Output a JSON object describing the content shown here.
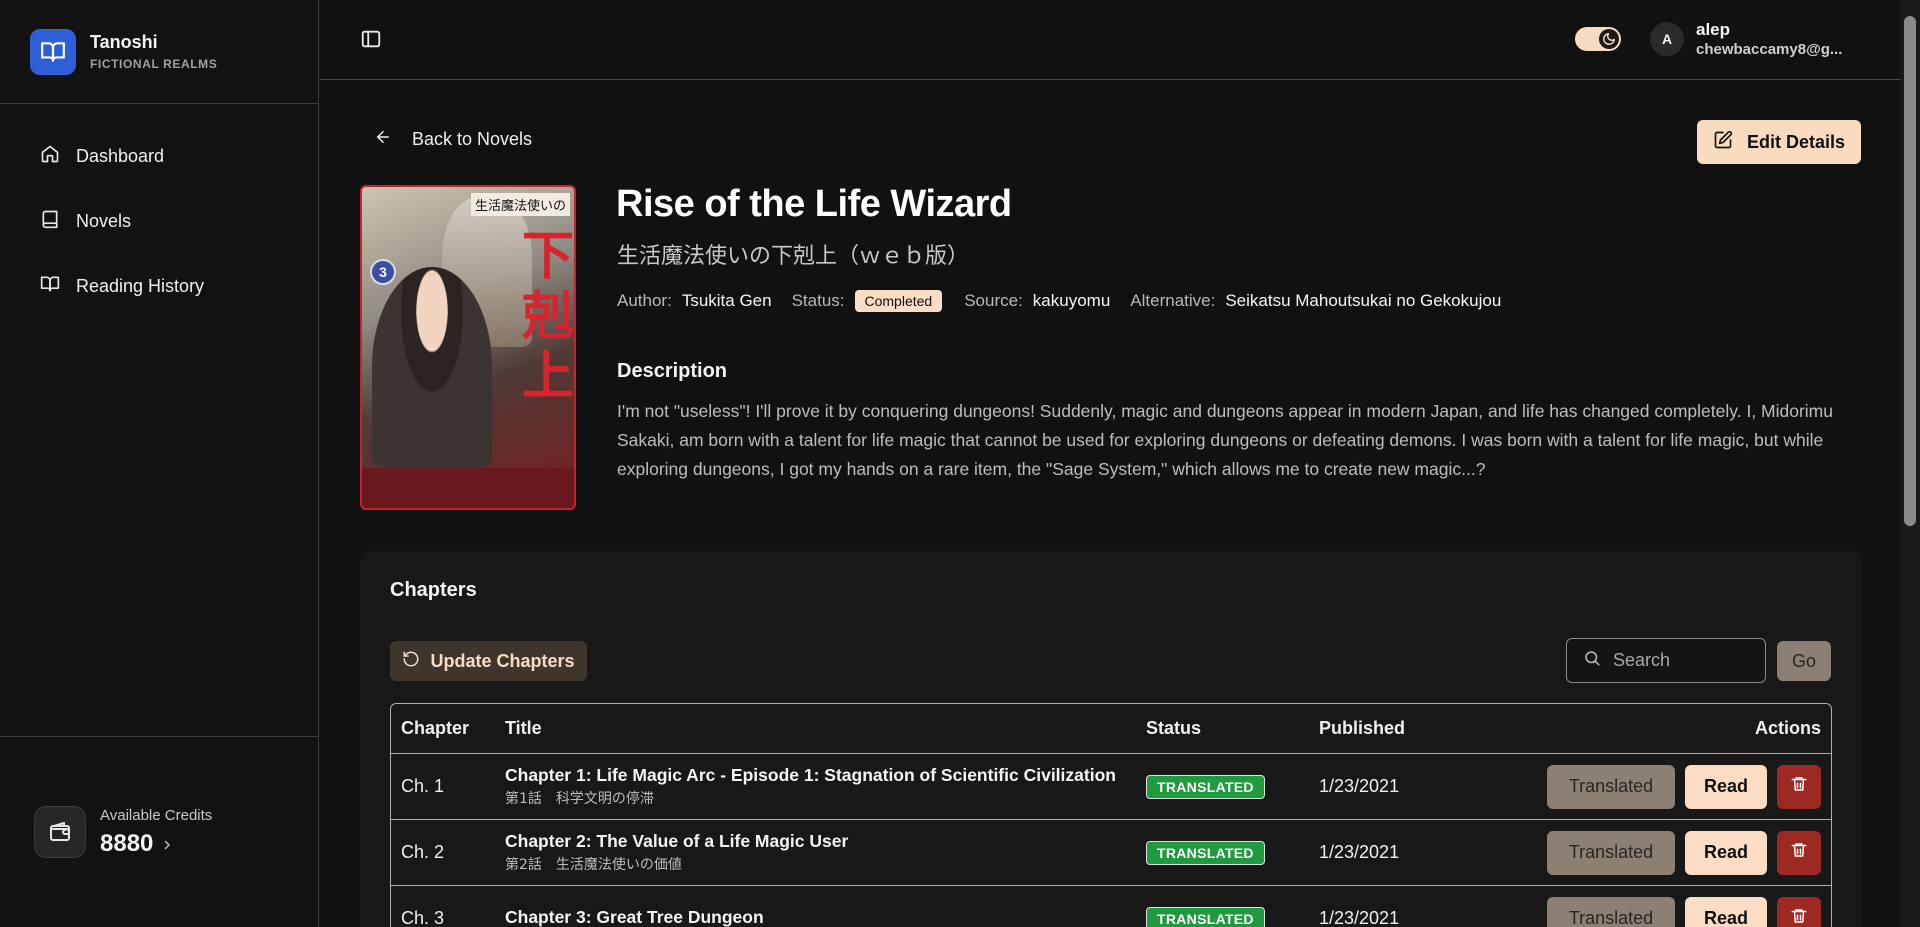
{
  "brand": {
    "name": "Tanoshi",
    "tagline": "FICTIONAL REALMS",
    "logo_icon": "book-open-icon",
    "logo_color": "#2f5fd6"
  },
  "nav": [
    {
      "label": "Dashboard",
      "icon": "home-icon"
    },
    {
      "label": "Novels",
      "icon": "book-icon"
    },
    {
      "label": "Reading History",
      "icon": "book-open-icon"
    }
  ],
  "credits": {
    "label": "Available Credits",
    "amount": "8880",
    "icon": "wallet-icon"
  },
  "topbar": {
    "theme_toggle": {
      "icon": "moon-icon",
      "state": "dark"
    },
    "user": {
      "initial": "A",
      "name": "alep",
      "email": "chewbaccamy8@g..."
    }
  },
  "page": {
    "back_label": "Back to Novels",
    "edit_label": "Edit Details",
    "cover": {
      "title_strip": "生活魔法使いの",
      "big_text": "下剋上",
      "volume": "3"
    },
    "title": "Rise of the Life Wizard",
    "original_title": "生活魔法使いの下剋上（ｗｅｂ版）",
    "meta": {
      "author_key": "Author:",
      "author": "Tsukita Gen",
      "status_key": "Status:",
      "status": "Completed",
      "source_key": "Source:",
      "source": "kakuyomu",
      "alt_key": "Alternative:",
      "alternative": "Seikatsu Mahoutsukai no Gekokujou"
    },
    "description_heading": "Description",
    "description": "I'm not \"useless\"! I'll prove it by conquering dungeons! Suddenly, magic and dungeons appear in modern Japan, and life has changed completely. I, Midorimu Sakaki, am born with a talent for life magic that cannot be used for exploring dungeons or defeating demons. I was born with a talent for life magic, but while exploring dungeons, I got my hands on a rare item, the \"Sage System,\" which allows me to create new magic...?"
  },
  "chapters": {
    "heading": "Chapters",
    "update_label": "Update Chapters",
    "search_placeholder": "Search",
    "go_label": "Go",
    "columns": {
      "chapter": "Chapter",
      "title": "Title",
      "status": "Status",
      "published": "Published",
      "actions": "Actions"
    },
    "rows": [
      {
        "num": "Ch. 1",
        "title": "Chapter 1: Life Magic Arc - Episode 1: Stagnation of Scientific Civilization",
        "subtitle": "第1話　科学文明の停滞",
        "status": "TRANSLATED",
        "published": "1/23/2021",
        "btn_translated": "Translated",
        "btn_read": "Read"
      },
      {
        "num": "Ch. 2",
        "title": "Chapter 2: The Value of a Life Magic User",
        "subtitle": "第2話　生活魔法使いの価値",
        "status": "TRANSLATED",
        "published": "1/23/2021",
        "btn_translated": "Translated",
        "btn_read": "Read"
      },
      {
        "num": "Ch. 3",
        "title": "Chapter 3: Great Tree Dungeon",
        "subtitle": "",
        "status": "TRANSLATED",
        "published": "1/23/2021",
        "btn_translated": "Translated",
        "btn_read": "Read"
      }
    ],
    "colors": {
      "translated_badge": "#1f9a3f",
      "delete": "#9c2a22",
      "read": "#fbdcc4"
    }
  }
}
